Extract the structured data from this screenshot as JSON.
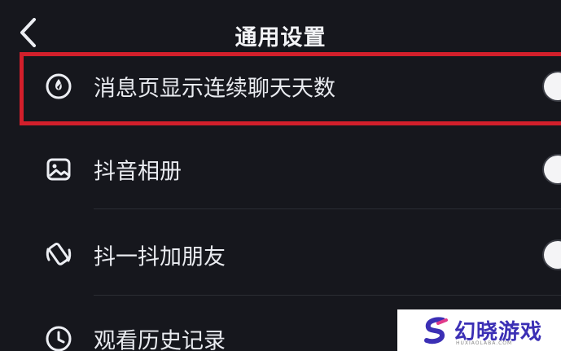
{
  "header": {
    "title": "通用设置"
  },
  "settings": [
    {
      "label": "消息页显示连续聊天天数",
      "icon": "flame-icon",
      "toggle_on": false
    },
    {
      "label": "抖音相册",
      "icon": "photo-album-icon",
      "toggle_on": false
    },
    {
      "label": "抖一抖加朋友",
      "icon": "shake-phone-icon",
      "toggle_on": false
    },
    {
      "label": "观看历史记录",
      "icon": "clock-icon"
    }
  ],
  "watermark": {
    "text": "幻晓游戏",
    "sub": "HUXIAOLABA.COM"
  },
  "colors": {
    "background": "#16171d",
    "highlight": "#d21f2b",
    "watermark_text": "#3b2fb5"
  }
}
